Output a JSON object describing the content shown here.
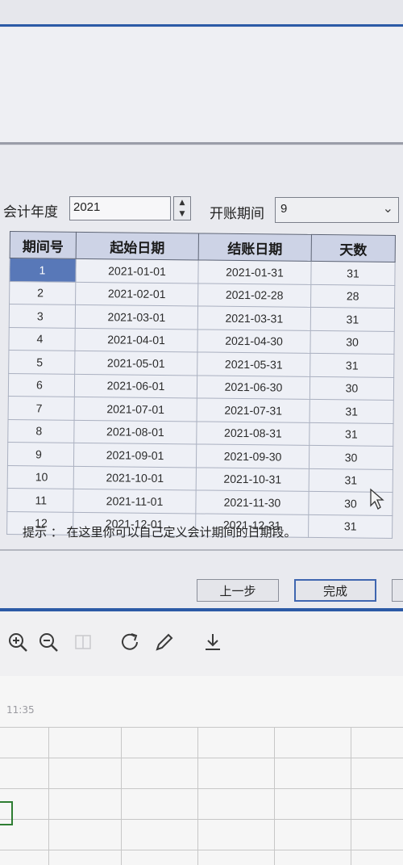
{
  "dialog": {
    "fiscal_year_label": "会计年度",
    "fiscal_year_value": "2021",
    "opening_period_label": "开账期间",
    "opening_period_value": "9",
    "hint": "提示 ： 在这里你可以自己定义会计期间的日期段。",
    "prev_label": "上一步",
    "finish_label": "完成"
  },
  "table": {
    "headers": [
      "期间号",
      "起始日期",
      "结账日期",
      "天数"
    ],
    "rows": [
      {
        "no": "1",
        "start": "2021-01-01",
        "end": "2021-01-31",
        "days": "31"
      },
      {
        "no": "2",
        "start": "2021-02-01",
        "end": "2021-02-28",
        "days": "28"
      },
      {
        "no": "3",
        "start": "2021-03-01",
        "end": "2021-03-31",
        "days": "31"
      },
      {
        "no": "4",
        "start": "2021-04-01",
        "end": "2021-04-30",
        "days": "30"
      },
      {
        "no": "5",
        "start": "2021-05-01",
        "end": "2021-05-31",
        "days": "31"
      },
      {
        "no": "6",
        "start": "2021-06-01",
        "end": "2021-06-30",
        "days": "30"
      },
      {
        "no": "7",
        "start": "2021-07-01",
        "end": "2021-07-31",
        "days": "31"
      },
      {
        "no": "8",
        "start": "2021-08-01",
        "end": "2021-08-31",
        "days": "31"
      },
      {
        "no": "9",
        "start": "2021-09-01",
        "end": "2021-09-30",
        "days": "30"
      },
      {
        "no": "10",
        "start": "2021-10-01",
        "end": "2021-10-31",
        "days": "31"
      },
      {
        "no": "11",
        "start": "2021-11-01",
        "end": "2021-11-30",
        "days": "30"
      },
      {
        "no": "12",
        "start": "2021-12-01",
        "end": "2021-12-31",
        "days": "31"
      }
    ]
  },
  "toolbar": {
    "icons": [
      "zoom-in-icon",
      "zoom-out-icon",
      "rotate-icon",
      "pencil-icon",
      "download-icon"
    ]
  },
  "sheet": {
    "time": "11:35"
  },
  "colors": {
    "accent_blue": "#2c5aa6",
    "selected_cell": "#5878b8",
    "header_bg": "#cdd3e6"
  }
}
